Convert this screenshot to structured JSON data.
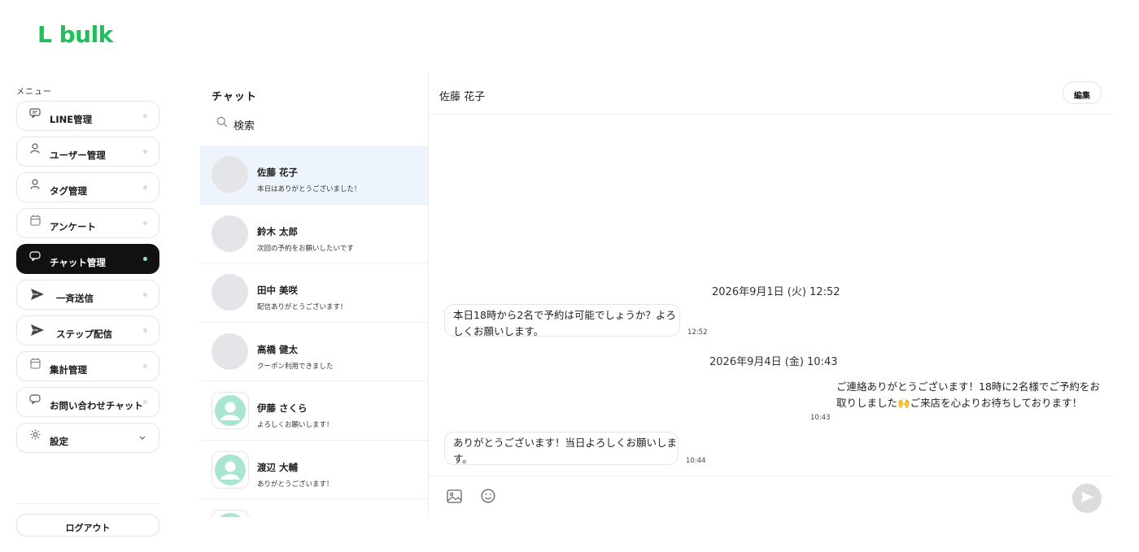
{
  "app": {
    "logo": "L bulk",
    "brand_color": "#1cc15a"
  },
  "sidebar": {
    "menu_label": "メニュー",
    "items": [
      {
        "label": "LINE管理",
        "icon": "chat-bubble-icon"
      },
      {
        "label": "ユーザー管理",
        "icon": "user-icon"
      },
      {
        "label": "タグ管理",
        "icon": "user-icon"
      },
      {
        "label": "アンケート",
        "icon": "calendar-icon"
      },
      {
        "label": "チャット管理",
        "icon": "chat-bubble-icon",
        "active": true
      },
      {
        "label": "一斉送信",
        "icon": "send-icon"
      },
      {
        "label": "ステップ配信",
        "icon": "send-icon"
      },
      {
        "label": "集計管理",
        "icon": "calendar-icon"
      },
      {
        "label": "お問い合わせチャット",
        "icon": "chat-bubble-icon"
      },
      {
        "label": "設定",
        "icon": "gear-icon",
        "has_chevron": true
      }
    ],
    "logout_label": "ログアウト"
  },
  "chatlist": {
    "title": "チャット",
    "search_placeholder": "検索",
    "conversations": [
      {
        "name": "佐藤 花子",
        "preview": "本日はありがとうございました！",
        "active": true,
        "avatar": "blank"
      },
      {
        "name": "鈴木 太郎",
        "preview": "次回の予約をお願いしたいです",
        "avatar": "blank"
      },
      {
        "name": "田中 美咲",
        "preview": "配信ありがとうございます！",
        "avatar": "blank"
      },
      {
        "name": "高橋 健太",
        "preview": "クーポン利用できました",
        "avatar": "blank"
      },
      {
        "name": "伊藤 さくら",
        "preview": "よろしくお願いします！",
        "avatar": "user"
      },
      {
        "name": "渡辺 大輔",
        "preview": "ありがとうございます！",
        "avatar": "user"
      }
    ]
  },
  "chat": {
    "contact_name": "佐藤 花子",
    "edit_label": "編集",
    "date_separators": [
      "2026年9月1日 (火) 12:52",
      "2026年9月4日 (金) 10:43"
    ],
    "messages": [
      {
        "direction": "in",
        "text": "本日18時から2名で予約は可能でしょうか？よろしくお願いします。",
        "time": "12:52"
      },
      {
        "direction": "out",
        "text": "ご連絡ありがとうございます！18時に2名様でご予約をお取りしました🙌ご来店を心よりお待ちしております！",
        "time": "10:43"
      },
      {
        "direction": "in",
        "text": "ありがとうございます！当日よろしくお願いします。",
        "time": "10:44"
      }
    ],
    "composer": {
      "tools": [
        "image-icon",
        "emoji-icon"
      ],
      "send_icon": "send-icon"
    }
  }
}
